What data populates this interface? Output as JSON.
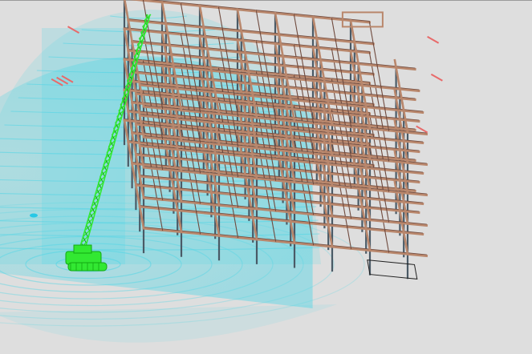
{
  "viewport": {
    "background": "#dedede"
  },
  "model": {
    "beam_color": "#b9876c",
    "beam_dark_color": "#6f4a3e",
    "column_color": "#4a5a66",
    "column_light_color": "#6f7e88",
    "slab_edge_color": "#e86a6a",
    "selection_outline_color": "#1f1f1f"
  },
  "crane": {
    "color": "#32e832",
    "dark_color": "#12a812",
    "radius_sphere_color": "#4fd6e6"
  },
  "marker": {
    "color": "#27c8e6"
  },
  "icons": {
    "crane": "crawler-crane-icon",
    "sphere": "crane-reach-sphere-icon",
    "marker": "point-marker-icon"
  }
}
